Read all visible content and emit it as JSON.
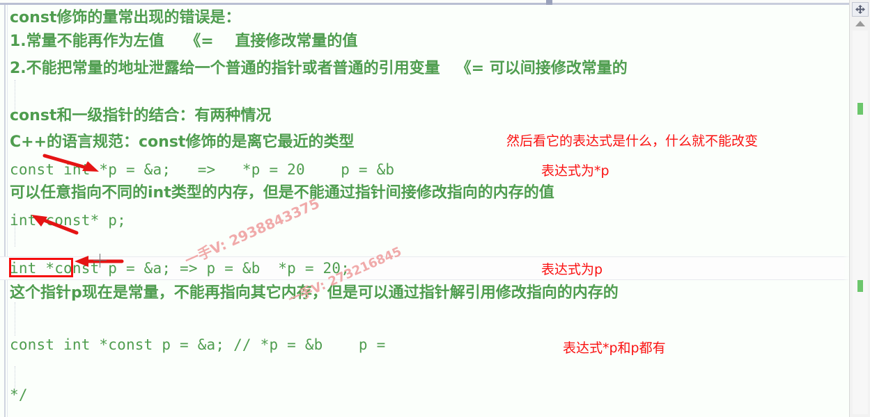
{
  "app": {
    "kind": "code-editor",
    "language": "C++",
    "colors": {
      "comment_green": "#4f9d4f",
      "annotation_red": "#fa1111",
      "marker_box_red": "#f50d0d",
      "background": "#fbfffb",
      "scrollbar_marker_green": "#6cc66c",
      "watermark_pink": "#f0a6a6"
    }
  },
  "editor": {
    "lines": [
      {
        "id": "l1",
        "text": "const修饰的量常出现的错误是：",
        "style": "cjk"
      },
      {
        "id": "l2",
        "text": "1.常量不能再作为左值    《=    直接修改常量的值",
        "style": "cjk"
      },
      {
        "id": "l3",
        "text": "2.不能把常量的地址泄露给一个普通的指针或者普通的引用变量   《= 可以间接修改常量的",
        "style": "cjk"
      },
      {
        "id": "l4",
        "text": "",
        "style": "mono"
      },
      {
        "id": "l5",
        "text": "const和一级指针的结合：有两种情况",
        "style": "cjk"
      },
      {
        "id": "l6",
        "text": "C++的语言规范：const修饰的是离它最近的类型",
        "style": "cjk"
      },
      {
        "id": "l7",
        "text": "const int *p = &a;   =>   *p = 20    p = &b",
        "style": "mono"
      },
      {
        "id": "l8",
        "text": "可以任意指向不同的int类型的内存，但是不能通过指针间接修改指向的内存的值",
        "style": "cjk"
      },
      {
        "id": "l9",
        "text": "int const* p;",
        "style": "mono"
      },
      {
        "id": "l10",
        "text": "",
        "style": "mono"
      },
      {
        "id": "l11",
        "text": "int *const p = &a; => p = &b  *p = 20;",
        "style": "mono"
      },
      {
        "id": "l12",
        "text": "这个指针p现在是常量，不能再指向其它内存，但是可以通过指针解引用修改指向的内存的",
        "style": "cjk"
      },
      {
        "id": "l13",
        "text": "",
        "style": "mono"
      },
      {
        "id": "l14",
        "text": "const int *const p = &a; // *p = &b    p = ",
        "style": "mono"
      },
      {
        "id": "l15",
        "text": "",
        "style": "mono"
      },
      {
        "id": "l16",
        "text": "*/",
        "style": "mono"
      }
    ]
  },
  "annotations": [
    {
      "id": "a1",
      "text": "然后看它的表达式是什么，什么就不能改变"
    },
    {
      "id": "a2",
      "text": "表达式为*p"
    },
    {
      "id": "a3",
      "text": "表达式为p"
    },
    {
      "id": "a4",
      "text": "表达式*p和p都有"
    }
  ],
  "watermarks": [
    {
      "id": "w1",
      "text": "一手V: 2938843375"
    },
    {
      "id": "w2",
      "text": "一手V: 273216845"
    }
  ],
  "scrollbar": {
    "split_icon": "split-editor-icon",
    "up_arrow_icon": "scroll-up-icon",
    "markers": [
      {
        "id": "m1",
        "label": "change-marker"
      },
      {
        "id": "m2",
        "label": "change-marker"
      }
    ]
  }
}
